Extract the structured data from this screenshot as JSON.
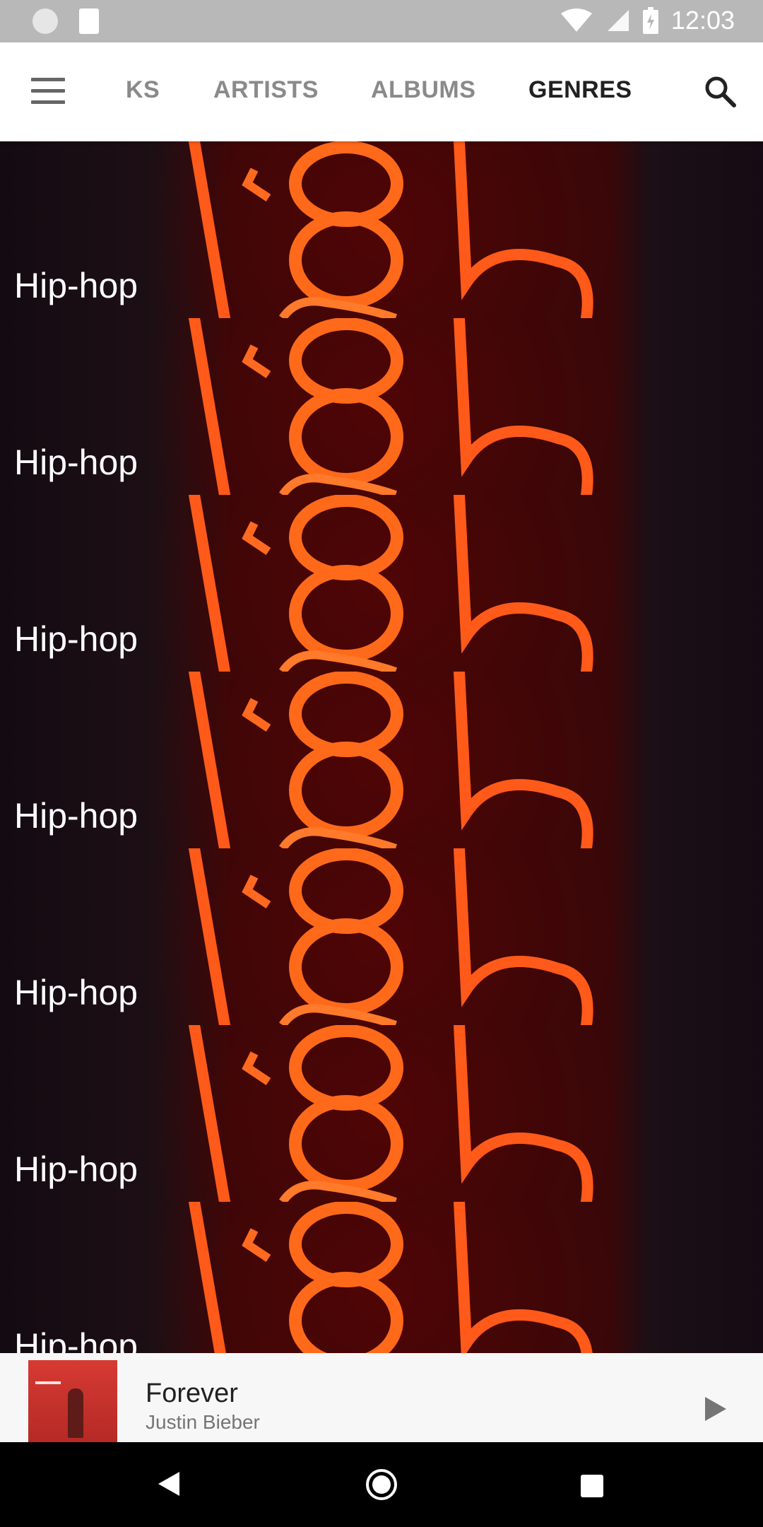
{
  "status_bar": {
    "time": "12:03"
  },
  "tabs": [
    {
      "label": "KS",
      "active": false
    },
    {
      "label": "ARTISTS",
      "active": false
    },
    {
      "label": "ALBUMS",
      "active": false
    },
    {
      "label": "GENRES",
      "active": true
    }
  ],
  "genres": [
    {
      "name": "Hip-hop"
    },
    {
      "name": "Hip-hop"
    },
    {
      "name": "Hip-hop"
    },
    {
      "name": "Hip-hop"
    },
    {
      "name": "Hip-hop"
    },
    {
      "name": "Hip-hop"
    },
    {
      "name": "Hip-hop"
    }
  ],
  "now_playing": {
    "title": "Forever",
    "artist": "Justin Bieber"
  },
  "icons": {
    "menu": "menu-icon",
    "search": "search-icon",
    "play": "play-icon",
    "back": "back-icon",
    "home": "home-icon",
    "recents": "recents-icon"
  },
  "colors": {
    "app_bar": "#ffffff",
    "active_tab": "#212121",
    "inactive_tab": "#8a8a8a",
    "mini_player": "#f7f7f7"
  }
}
